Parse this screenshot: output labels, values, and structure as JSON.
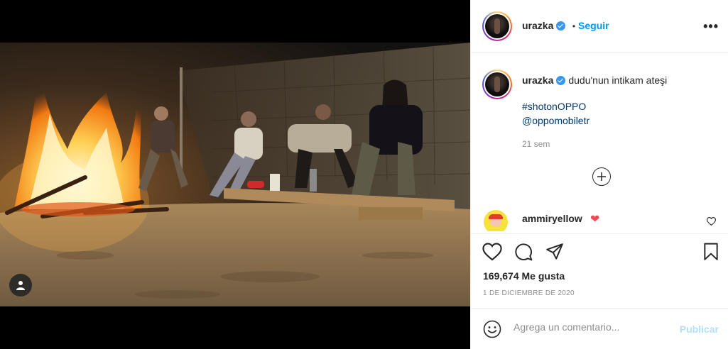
{
  "post": {
    "username": "urazka",
    "verified": true,
    "follow_label": "Seguir",
    "separator": "•",
    "more_label": "•••",
    "caption_text": "dudu'nun intikam ateşi",
    "hashtag": "#shotonOPPO",
    "mention": "@oppomobiletr",
    "time_ago": "21 sem",
    "likes_text": "169,674 Me gusta",
    "date_text": "1 de diciembre de 2020"
  },
  "comments": [
    {
      "username": "ammiryellow",
      "emoji": "❤"
    }
  ],
  "add_comment": {
    "placeholder": "Agrega un comentario...",
    "publish_label": "Publicar"
  },
  "icons": {
    "like": "heart-icon",
    "comment": "comment-icon",
    "share": "share-icon",
    "save": "bookmark-icon",
    "more": "more-options-icon",
    "load_more": "plus-circle-icon",
    "emoji": "emoji-icon",
    "tag": "user-tag-icon"
  },
  "colors": {
    "accent": "#0095f6",
    "publish_disabled": "#b2dffc",
    "heart": "#ed4956",
    "verified": "#3897f0"
  }
}
